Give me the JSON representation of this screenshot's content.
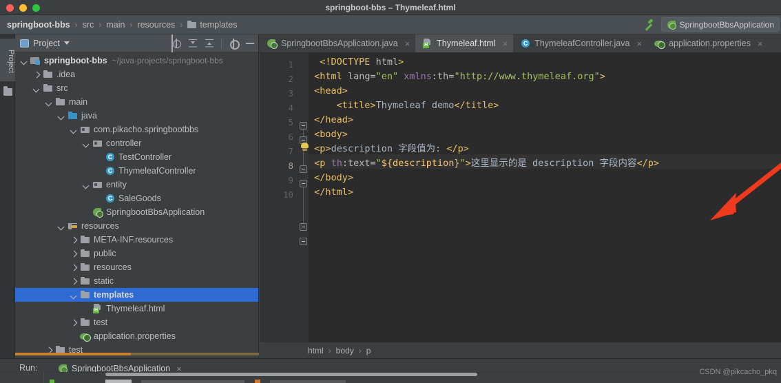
{
  "window": {
    "title": "springboot-bbs – Thymeleaf.html",
    "traffic": {
      "close": "close",
      "minimize": "minimize",
      "zoom": "zoom"
    }
  },
  "navbar": {
    "breadcrumbs": [
      {
        "label": "springboot-bbs",
        "icon": "",
        "bold": true
      },
      {
        "label": "src",
        "icon": "",
        "bold": false
      },
      {
        "label": "main",
        "icon": "",
        "bold": false
      },
      {
        "label": "resources",
        "icon": "",
        "bold": false
      },
      {
        "label": "templates",
        "icon": "folder-icon",
        "bold": false
      }
    ],
    "separator": "›",
    "build_icon": "hammer-icon",
    "run_config": "SpringbootBbsApplication",
    "run_config_icon": "spring-boot-icon"
  },
  "toolstrip": {
    "project_label": "Project",
    "folder_icon": "folder-icon"
  },
  "project_panel": {
    "title": "Project",
    "caret": "chevron-down-icon",
    "tools": [
      "locate-icon",
      "expand-all-icon",
      "collapse-all-icon",
      "gear-icon",
      "minimize-icon"
    ],
    "tree": [
      {
        "indent": 0,
        "arrow": "down",
        "icon": "module-icon",
        "label": "springboot-bbs",
        "path": "~/java-projects/springboot-bbs",
        "bold": true,
        "selected": false
      },
      {
        "indent": 1,
        "arrow": "right",
        "icon": "folder-icon",
        "label": ".idea",
        "path": "",
        "bold": false,
        "selected": false
      },
      {
        "indent": 1,
        "arrow": "down",
        "icon": "folder-icon",
        "label": "src",
        "path": "",
        "bold": false,
        "selected": false
      },
      {
        "indent": 2,
        "arrow": "down",
        "icon": "folder-icon",
        "label": "main",
        "path": "",
        "bold": false,
        "selected": false
      },
      {
        "indent": 3,
        "arrow": "down",
        "icon": "folder-blue-icon",
        "label": "java",
        "path": "",
        "bold": false,
        "selected": false
      },
      {
        "indent": 4,
        "arrow": "down",
        "icon": "package-icon",
        "label": "com.pikacho.springbootbbs",
        "path": "",
        "bold": false,
        "selected": false
      },
      {
        "indent": 5,
        "arrow": "down",
        "icon": "package-icon",
        "label": "controller",
        "path": "",
        "bold": false,
        "selected": false
      },
      {
        "indent": 6,
        "arrow": "none",
        "icon": "java-class-icon",
        "label": "TestController",
        "path": "",
        "bold": false,
        "selected": false
      },
      {
        "indent": 6,
        "arrow": "none",
        "icon": "java-class-icon",
        "label": "ThymeleafController",
        "path": "",
        "bold": false,
        "selected": false
      },
      {
        "indent": 5,
        "arrow": "down",
        "icon": "package-icon",
        "label": "entity",
        "path": "",
        "bold": false,
        "selected": false
      },
      {
        "indent": 6,
        "arrow": "none",
        "icon": "java-class-icon",
        "label": "SaleGoods",
        "path": "",
        "bold": false,
        "selected": false
      },
      {
        "indent": 5,
        "arrow": "none",
        "icon": "spring-boot-icon",
        "label": "SpringbootBbsApplication",
        "path": "",
        "bold": false,
        "selected": false
      },
      {
        "indent": 3,
        "arrow": "down",
        "icon": "folder-resources-icon",
        "label": "resources",
        "path": "",
        "bold": false,
        "selected": false
      },
      {
        "indent": 4,
        "arrow": "right",
        "icon": "folder-icon",
        "label": "META-INF.resources",
        "path": "",
        "bold": false,
        "selected": false
      },
      {
        "indent": 4,
        "arrow": "right",
        "icon": "folder-icon",
        "label": "public",
        "path": "",
        "bold": false,
        "selected": false
      },
      {
        "indent": 4,
        "arrow": "right",
        "icon": "folder-icon",
        "label": "resources",
        "path": "",
        "bold": false,
        "selected": false
      },
      {
        "indent": 4,
        "arrow": "right",
        "icon": "folder-icon",
        "label": "static",
        "path": "",
        "bold": false,
        "selected": false
      },
      {
        "indent": 4,
        "arrow": "down",
        "icon": "folder-icon",
        "label": "templates",
        "path": "",
        "bold": true,
        "selected": true
      },
      {
        "indent": 5,
        "arrow": "none",
        "icon": "html-file-icon",
        "label": "Thymeleaf.html",
        "path": "",
        "bold": false,
        "selected": false
      },
      {
        "indent": 4,
        "arrow": "right",
        "icon": "folder-icon",
        "label": "test",
        "path": "",
        "bold": false,
        "selected": false
      },
      {
        "indent": 4,
        "arrow": "none",
        "icon": "properties-icon",
        "label": "application.properties",
        "path": "",
        "bold": false,
        "selected": false
      },
      {
        "indent": 2,
        "arrow": "right",
        "icon": "folder-icon",
        "label": "test",
        "path": "",
        "bold": false,
        "selected": false
      }
    ]
  },
  "editor_tabs": [
    {
      "label": "SpringbootBbsApplication.java",
      "icon": "spring-boot-icon",
      "active": false,
      "close": "×"
    },
    {
      "label": "Thymeleaf.html",
      "icon": "html-file-icon",
      "active": true,
      "close": "×"
    },
    {
      "label": "ThymeleafController.java",
      "icon": "java-class-icon",
      "active": false,
      "close": "×"
    },
    {
      "label": "application.properties",
      "icon": "properties-icon",
      "active": false,
      "close": "×"
    }
  ],
  "editor": {
    "language": "HTML",
    "highlighted_line": 8,
    "colors": {
      "background": "#2b2b2b",
      "gutter": "#313335",
      "tag": "#e8bf6a",
      "attribute": "#bababa",
      "namespace": "#9876aa",
      "value": "#a5c261",
      "text": "#a9b7c6",
      "expression": "#ffc66d",
      "line_number": "#606366",
      "highlight_row": "#323232"
    },
    "lines": [
      {
        "n": 1,
        "text": "  <!DOCTYPE html>"
      },
      {
        "n": 2,
        "text": " <html lang=\"en\" xmlns:th=\"http://www.thymeleaf.org\">"
      },
      {
        "n": 3,
        "text": " <head>"
      },
      {
        "n": 4,
        "text": "     <title>Thymeleaf demo</title>"
      },
      {
        "n": 5,
        "text": " </head>"
      },
      {
        "n": 6,
        "text": " <body>"
      },
      {
        "n": 7,
        "text": " <p>description 字段值为: </p>"
      },
      {
        "n": 8,
        "text": " <p th:text=\"${description}\">这里显示的是 description 字段内容</p>"
      },
      {
        "n": 9,
        "text": " </body>"
      },
      {
        "n": 10,
        "text": " </html>"
      }
    ],
    "breadcrumbs": [
      "html",
      "body",
      "p"
    ],
    "breadcrumb_separator": "›",
    "intention_icon": "lightbulb-icon",
    "annotation_arrow": "red-arrow-pointing-to-line-8"
  },
  "run_panel": {
    "label": "Run:",
    "tab_label": "SpringbootBbsApplication",
    "tab_icon": "spring-boot-icon",
    "tab_close": "×"
  },
  "watermark": "CSDN @pikcacho_pkq"
}
